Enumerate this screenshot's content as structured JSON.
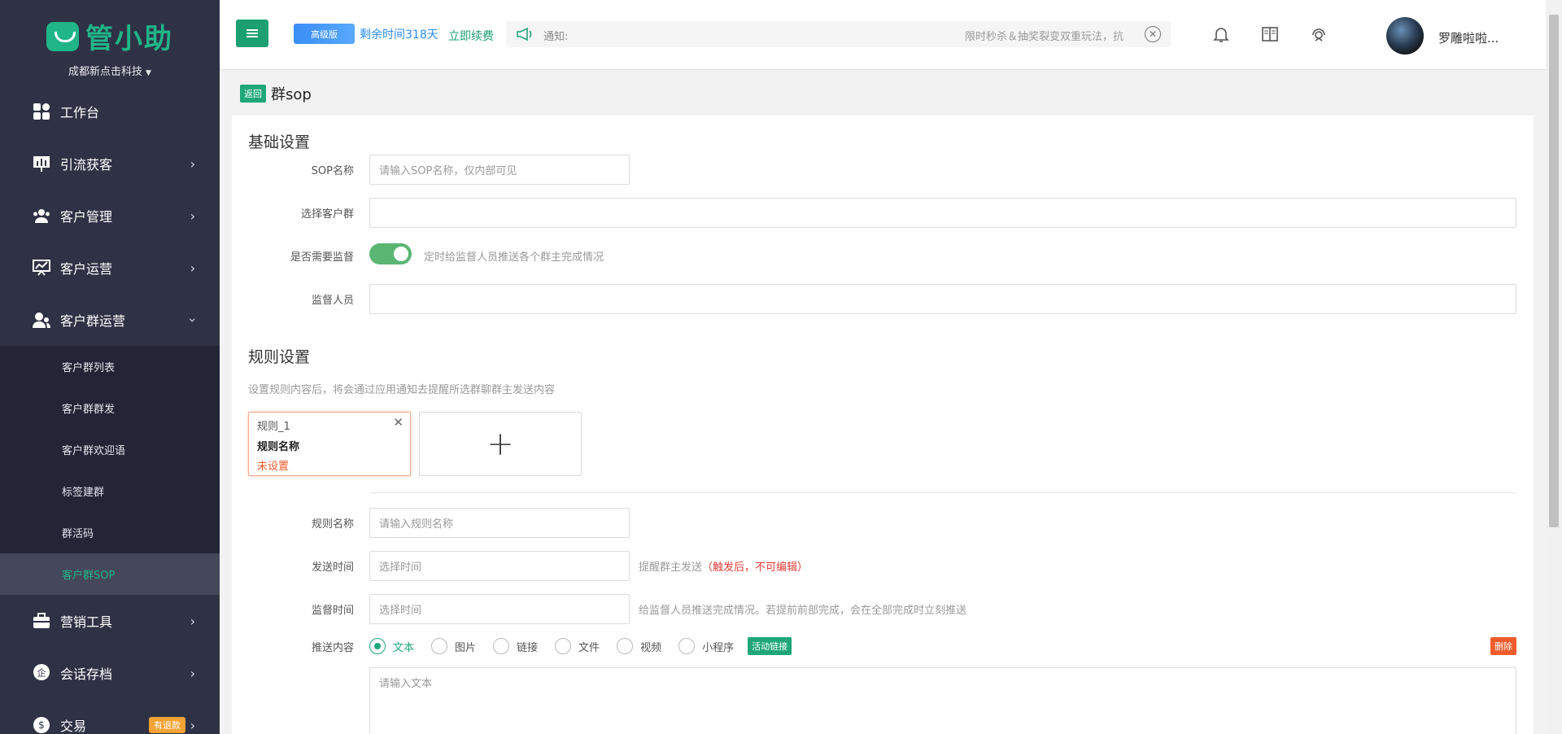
{
  "sidebar": {
    "logo_text": "管小助",
    "company": "成都新点击科技",
    "items": [
      {
        "label": "工作台",
        "icon": "dashboard-icon"
      },
      {
        "label": "引流获客",
        "icon": "chart-board-icon"
      },
      {
        "label": "客户管理",
        "icon": "users-icon"
      },
      {
        "label": "客户运营",
        "icon": "presentation-icon"
      },
      {
        "label": "客户群运营",
        "icon": "group-user-icon"
      },
      {
        "label": "营销工具",
        "icon": "briefcase-icon"
      },
      {
        "label": "会话存档",
        "icon": "enterprise-chat-icon"
      },
      {
        "label": "交易",
        "icon": "trade-icon",
        "badge": "有退款"
      }
    ],
    "submenu": [
      {
        "label": "客户群列表"
      },
      {
        "label": "客户群群发"
      },
      {
        "label": "客户群欢迎语"
      },
      {
        "label": "标签建群"
      },
      {
        "label": "群活码"
      },
      {
        "label": "客户群SOP"
      }
    ]
  },
  "header": {
    "edition": "高级版",
    "remaining": "剩余时间318天",
    "renew": "立即续费",
    "notice_label": "通知:",
    "notice_text": "限时秒杀＆抽奖裂变双重玩法，抗",
    "user_name": "罗雕啦啦..."
  },
  "page": {
    "back_label": "返回",
    "title": "群sop",
    "basic_title": "基础设置",
    "sop_name_label": "SOP名称",
    "sop_name_placeholder": "请输入SOP名称，仅内部可见",
    "group_label": "选择客户群",
    "supervise_label": "是否需要监督",
    "supervise_on": true,
    "supervise_hint": "定时给监督人员推送各个群主完成情况",
    "supervisor_label": "监督人员",
    "rule_title": "规则设置",
    "rule_desc": "设置规则内容后，将会通过应用通知去提醒所选群聊群主发送内容",
    "rule_card": {
      "title": "规则_1",
      "name": "规则名称",
      "status": "未设置"
    },
    "add_symbol": "+",
    "rule_name_label": "规则名称",
    "rule_name_placeholder": "请输入规则名称",
    "send_time_label": "发送时间",
    "send_time_placeholder": "选择时间",
    "send_hint": "提醒群主发送",
    "send_hint_red": "（触发后，不可编辑）",
    "supervise_time_label": "监督时间",
    "supervise_time_placeholder": "选择时间",
    "supervise_time_hint": "给监督人员推送完成情况。若提前前部完成，会在全部完成时立刻推送",
    "push_label": "推送内容",
    "push_types": [
      "文本",
      "图片",
      "链接",
      "文件",
      "视频",
      "小程序"
    ],
    "push_selected": "文本",
    "activity_link": "活动链接",
    "delete_label": "删除",
    "text_placeholder": "请输入文本"
  },
  "colors": {
    "brand": "#1fa779",
    "sidebar_bg": "#2f3245",
    "warn": "#f05b2b"
  }
}
